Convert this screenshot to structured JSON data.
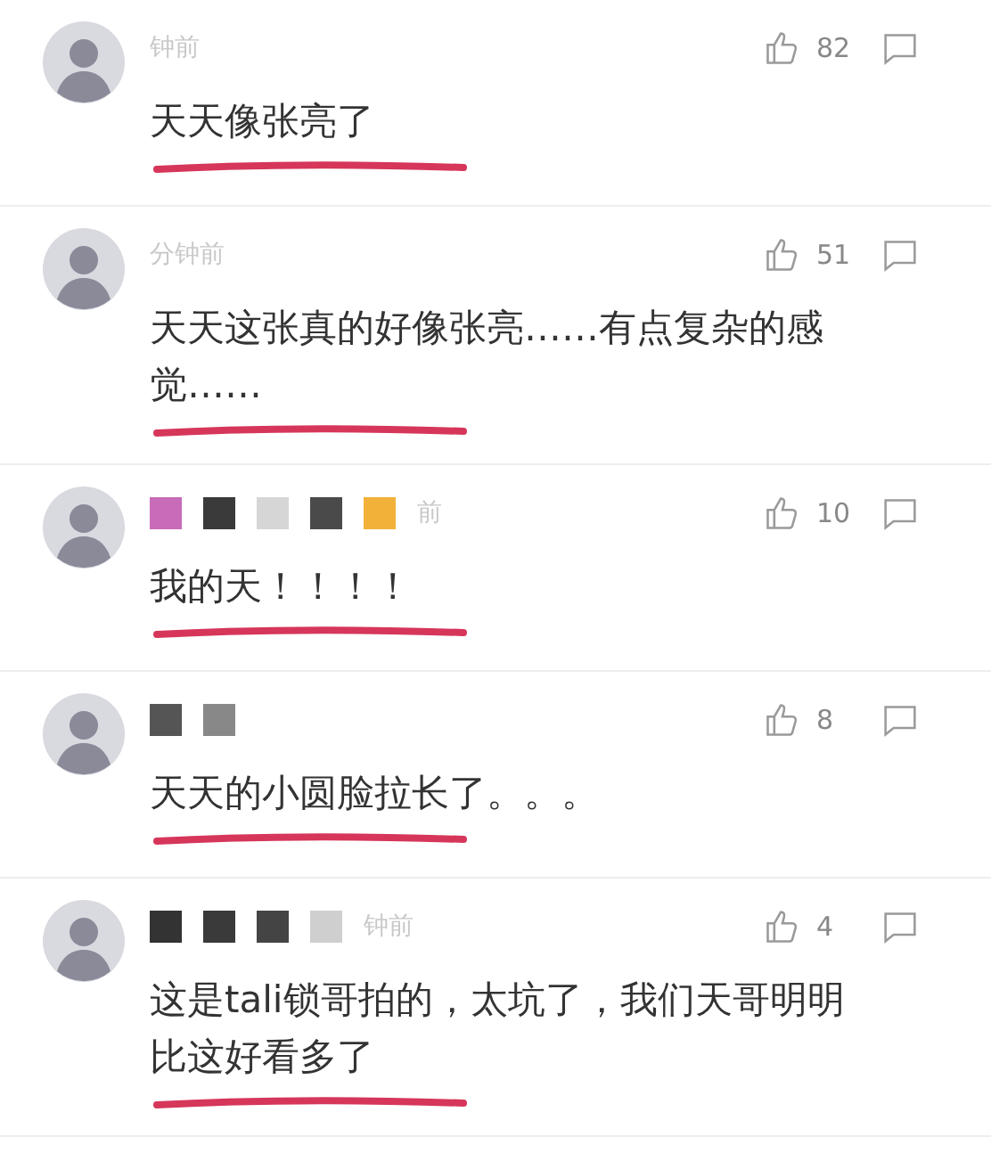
{
  "comments": [
    {
      "time": "钟前",
      "likes": "82",
      "text": "天天像张亮了"
    },
    {
      "time": "分钟前",
      "likes": "51",
      "text": "天天这张真的好像张亮……有点复杂的感觉……"
    },
    {
      "time": "前",
      "likes": "10",
      "text": "我的天！！！！",
      "blocks": [
        {
          "color": "#c86bb8"
        },
        {
          "color": "#3a3a3a"
        },
        {
          "color": "#d6d6d6"
        },
        {
          "color": "#4a4a4a"
        },
        {
          "color": "#f2b23a"
        }
      ]
    },
    {
      "likes": "8",
      "text": "天天的小圆脸拉长了。。。",
      "blocks": [
        {
          "color": "#555555"
        },
        {
          "color": "#888888"
        }
      ]
    },
    {
      "time": "钟前",
      "likes": "4",
      "text": "这是tali锁哥拍的，太坑了，我们天哥明明比这好看多了",
      "blocks": [
        {
          "color": "#333333"
        },
        {
          "color": "#3a3a3a"
        },
        {
          "color": "#444444"
        },
        {
          "color": "#cfcfcf"
        }
      ]
    }
  ]
}
